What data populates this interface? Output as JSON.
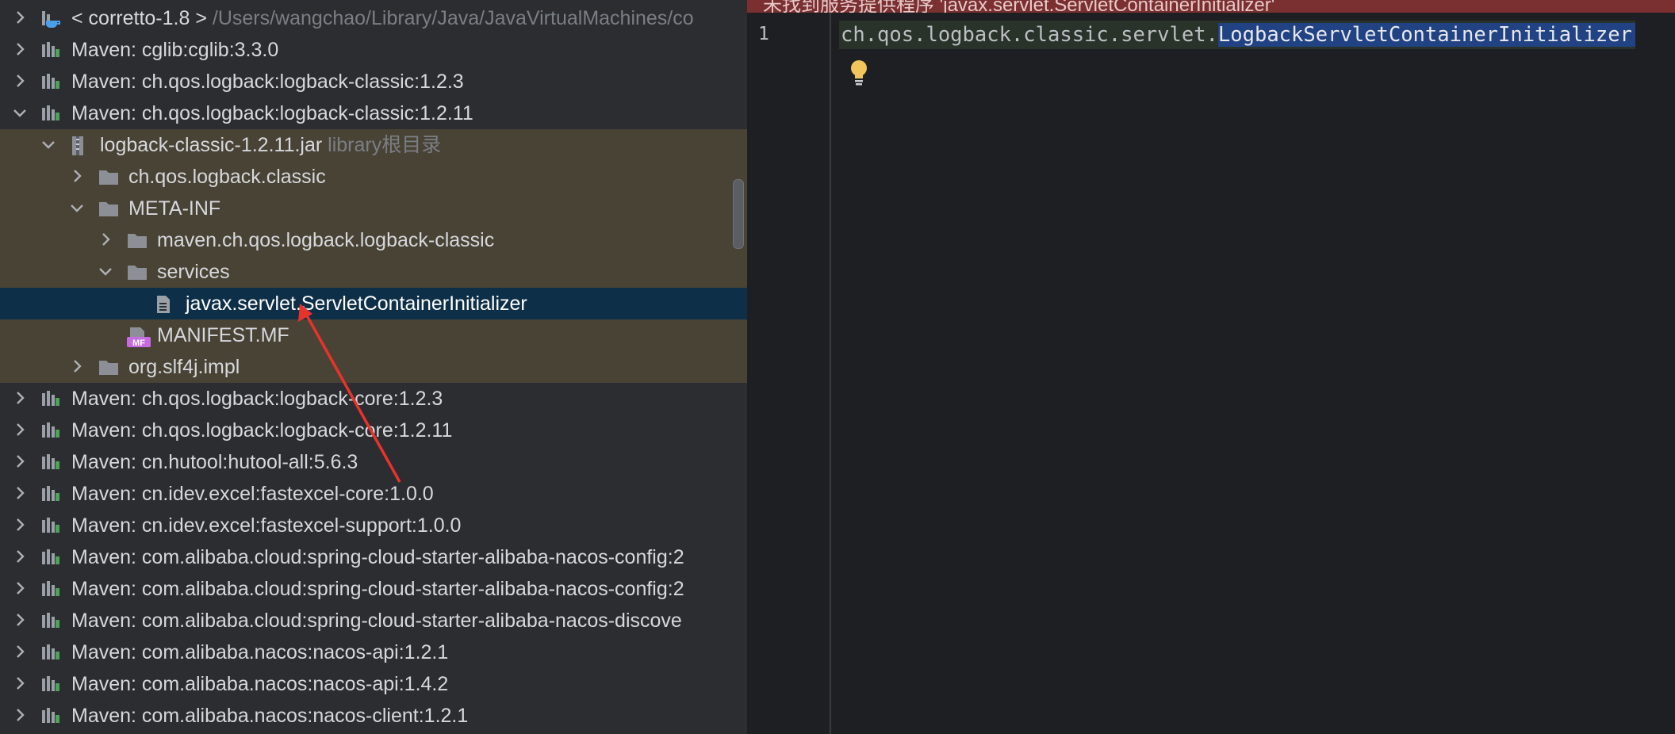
{
  "tree": {
    "rows": [
      {
        "label": "< corretto-1.8 >",
        "hint": "/Users/wangchao/Library/Java/JavaVirtualMachines/co",
        "icon": "jdk-icon",
        "depth": 0,
        "state": "collapsed",
        "hl": "none"
      },
      {
        "label": "Maven: cglib:cglib:3.3.0",
        "hint": "",
        "icon": "library-icon",
        "depth": 0,
        "state": "collapsed",
        "hl": "none"
      },
      {
        "label": "Maven: ch.qos.logback:logback-classic:1.2.3",
        "hint": "",
        "icon": "library-icon",
        "depth": 0,
        "state": "collapsed",
        "hl": "none"
      },
      {
        "label": "Maven: ch.qos.logback:logback-classic:1.2.11",
        "hint": "",
        "icon": "library-icon",
        "depth": 0,
        "state": "expanded",
        "hl": "none"
      },
      {
        "label": "logback-classic-1.2.11.jar",
        "hint": "library根目录",
        "icon": "jar-icon",
        "depth": 1,
        "state": "expanded",
        "hl": "scope"
      },
      {
        "label": "ch.qos.logback.classic",
        "hint": "",
        "icon": "folder-icon",
        "depth": 2,
        "state": "collapsed",
        "hl": "scope"
      },
      {
        "label": "META-INF",
        "hint": "",
        "icon": "folder-icon",
        "depth": 2,
        "state": "expanded",
        "hl": "scope"
      },
      {
        "label": "maven.ch.qos.logback.logback-classic",
        "hint": "",
        "icon": "folder-icon",
        "depth": 3,
        "state": "collapsed",
        "hl": "scope"
      },
      {
        "label": "services",
        "hint": "",
        "icon": "folder-icon",
        "depth": 3,
        "state": "expanded",
        "hl": "scope"
      },
      {
        "label": "javax.servlet.ServletContainerInitializer",
        "hint": "",
        "icon": "file-icon",
        "depth": 4,
        "state": "leaf",
        "hl": "selected"
      },
      {
        "label": "MANIFEST.MF",
        "hint": "",
        "icon": "manifest-icon",
        "depth": 3,
        "state": "leaf",
        "hl": "scope"
      },
      {
        "label": "org.slf4j.impl",
        "hint": "",
        "icon": "folder-icon",
        "depth": 2,
        "state": "collapsed",
        "hl": "scope"
      },
      {
        "label": "Maven: ch.qos.logback:logback-core:1.2.3",
        "hint": "",
        "icon": "library-icon",
        "depth": 0,
        "state": "collapsed",
        "hl": "none"
      },
      {
        "label": "Maven: ch.qos.logback:logback-core:1.2.11",
        "hint": "",
        "icon": "library-icon",
        "depth": 0,
        "state": "collapsed",
        "hl": "none"
      },
      {
        "label": "Maven: cn.hutool:hutool-all:5.6.3",
        "hint": "",
        "icon": "library-icon",
        "depth": 0,
        "state": "collapsed",
        "hl": "none"
      },
      {
        "label": "Maven: cn.idev.excel:fastexcel-core:1.0.0",
        "hint": "",
        "icon": "library-icon",
        "depth": 0,
        "state": "collapsed",
        "hl": "none"
      },
      {
        "label": "Maven: cn.idev.excel:fastexcel-support:1.0.0",
        "hint": "",
        "icon": "library-icon",
        "depth": 0,
        "state": "collapsed",
        "hl": "none"
      },
      {
        "label": "Maven: com.alibaba.cloud:spring-cloud-starter-alibaba-nacos-config:2",
        "hint": "",
        "icon": "library-icon",
        "depth": 0,
        "state": "collapsed",
        "hl": "none"
      },
      {
        "label": "Maven: com.alibaba.cloud:spring-cloud-starter-alibaba-nacos-config:2",
        "hint": "",
        "icon": "library-icon",
        "depth": 0,
        "state": "collapsed",
        "hl": "none"
      },
      {
        "label": "Maven: com.alibaba.cloud:spring-cloud-starter-alibaba-nacos-discove",
        "hint": "",
        "icon": "library-icon",
        "depth": 0,
        "state": "collapsed",
        "hl": "none"
      },
      {
        "label": "Maven: com.alibaba.nacos:nacos-api:1.2.1",
        "hint": "",
        "icon": "library-icon",
        "depth": 0,
        "state": "collapsed",
        "hl": "none"
      },
      {
        "label": "Maven: com.alibaba.nacos:nacos-api:1.4.2",
        "hint": "",
        "icon": "library-icon",
        "depth": 0,
        "state": "collapsed",
        "hl": "none"
      },
      {
        "label": "Maven: com.alibaba.nacos:nacos-client:1.2.1",
        "hint": "",
        "icon": "library-icon",
        "depth": 0,
        "state": "collapsed",
        "hl": "none"
      }
    ]
  },
  "editor": {
    "banner": "未找到服务提供程序 'javax.servlet.ServletContainerInitializer'",
    "line_number": "1",
    "code_package": "ch.qos.logback.classic.servlet.",
    "code_class": "LogbackServletContainerInitializer"
  },
  "colors": {
    "selection": "#0d2f47",
    "scope_highlight": "#494335",
    "annotation_arrow": "#e8332b",
    "banner": "#7a2f31",
    "identifier_highlight": "#214283"
  },
  "annotation": {
    "type": "arrow",
    "icon": "red-arrow"
  }
}
